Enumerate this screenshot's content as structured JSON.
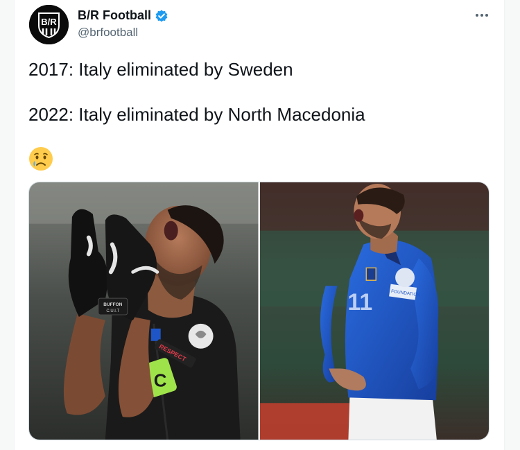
{
  "tweet": {
    "author": {
      "display_name": "B/R Football",
      "handle": "@brfootball",
      "avatar_text": "B/R",
      "verified": true
    },
    "lines": [
      "2017: Italy eliminated by Sweden",
      "2022: Italy eliminated by North Macedonia"
    ],
    "emoji": "crying-face-emoji",
    "media": [
      {
        "type": "photo",
        "icon": "goalkeeper-photo",
        "glove_label": [
          "BUFFON",
          "C.U.I.T"
        ],
        "armband_text": "C",
        "sleeve_badge_text": "RESPECT"
      },
      {
        "type": "photo",
        "icon": "outfield-player-photo",
        "sleeve_badge_text": "FOUNDATION"
      }
    ]
  },
  "colors": {
    "verified_blue": "#1d9bf0",
    "text_primary": "#0f1419",
    "text_secondary": "#536471",
    "border": "#cfd9de",
    "italy_home_blue": "#1e56c8",
    "goalkeeper_black": "#1a1a1a",
    "captain_armband": "#9fe34a"
  }
}
